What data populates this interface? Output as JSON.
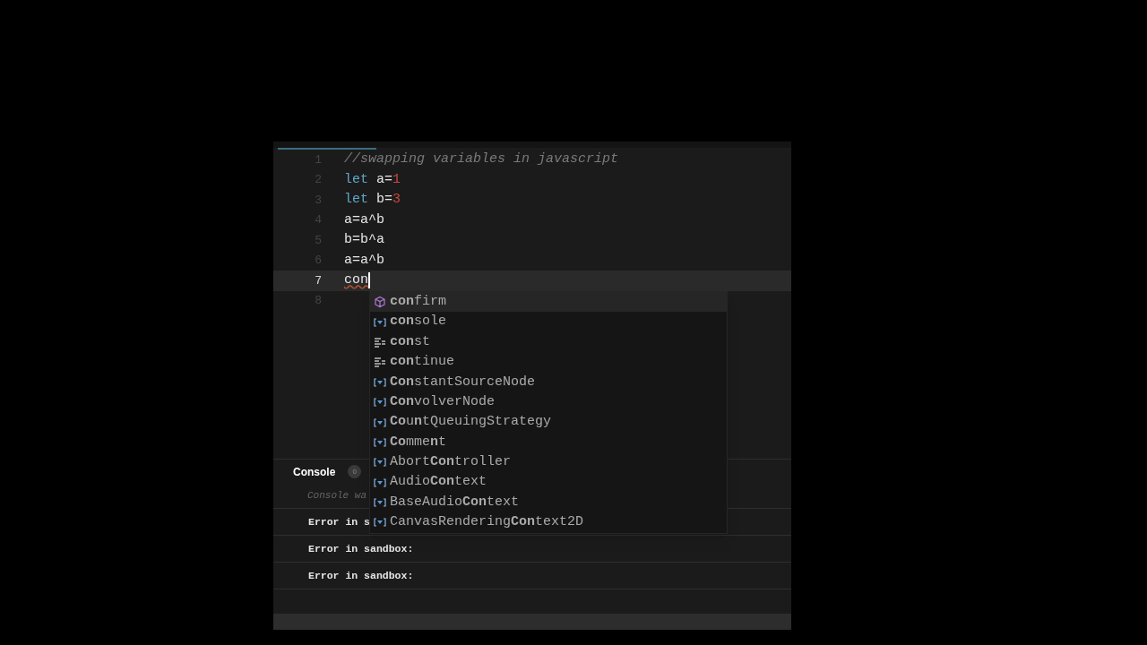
{
  "editor": {
    "lines": [
      {
        "number": "1",
        "current": false,
        "tokens": [
          {
            "kind": "comment",
            "text": "//swapping variables in javascript"
          }
        ]
      },
      {
        "number": "2",
        "current": false,
        "tokens": [
          {
            "kind": "keyword",
            "text": "let"
          },
          {
            "kind": "plain",
            "text": " a="
          },
          {
            "kind": "number",
            "text": "1"
          }
        ]
      },
      {
        "number": "3",
        "current": false,
        "tokens": [
          {
            "kind": "keyword",
            "text": "let"
          },
          {
            "kind": "plain",
            "text": " b="
          },
          {
            "kind": "number",
            "text": "3"
          }
        ]
      },
      {
        "number": "4",
        "current": false,
        "tokens": [
          {
            "kind": "plain",
            "text": "a=a^b"
          }
        ]
      },
      {
        "number": "5",
        "current": false,
        "tokens": [
          {
            "kind": "plain",
            "text": "b=b^a"
          }
        ]
      },
      {
        "number": "6",
        "current": false,
        "tokens": [
          {
            "kind": "plain",
            "text": "a=a^b"
          }
        ]
      },
      {
        "number": "7",
        "current": true,
        "tokens": [
          {
            "kind": "error",
            "text": "con"
          }
        ]
      },
      {
        "number": "8",
        "current": false
      }
    ]
  },
  "suggestions": [
    {
      "kind": "method",
      "label": "**con**firm",
      "selected": true
    },
    {
      "kind": "variable",
      "label": "**con**sole",
      "selected": false
    },
    {
      "kind": "keyword",
      "label": "**con**st",
      "selected": false
    },
    {
      "kind": "keyword",
      "label": "**con**tinue",
      "selected": false
    },
    {
      "kind": "variable",
      "label": "**Con**stantSourceNode",
      "selected": false
    },
    {
      "kind": "variable",
      "label": "**Con**volverNode",
      "selected": false
    },
    {
      "kind": "variable",
      "label": "**Co**u**n**tQueuingStrategy",
      "selected": false
    },
    {
      "kind": "variable",
      "label": "**Co**mme**n**t",
      "selected": false
    },
    {
      "kind": "variable",
      "label": "Abort**Con**troller",
      "selected": false
    },
    {
      "kind": "variable",
      "label": "Audio**Con**text",
      "selected": false
    },
    {
      "kind": "variable",
      "label": "BaseAudio**Con**text",
      "selected": false
    },
    {
      "kind": "variable",
      "label": "CanvasRendering**Con**text2D",
      "selected": false
    }
  ],
  "console": {
    "title": "Console",
    "count": "0",
    "message": "Console wa",
    "entries": [
      "Error in s",
      "Error in sandbox:",
      "Error in sandbox:"
    ]
  }
}
